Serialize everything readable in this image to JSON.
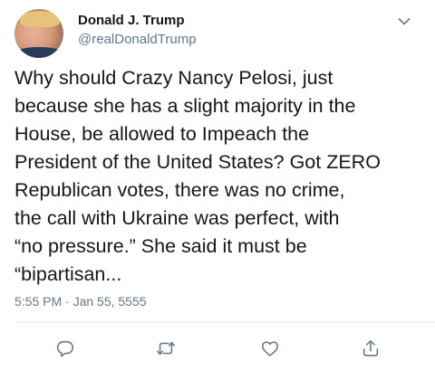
{
  "user": {
    "display_name": "Donald J. Trump",
    "handle": "@realDonaldTrump"
  },
  "tweet": {
    "text": "Why should Crazy Nancy Pelosi, just\nbecause she has a slight majority in the\nHouse, be allowed to Impeach the\nPresident of the United States? Got ZERO\nRepublican votes, there was no crime,\nthe call with Ukraine was perfect, with\n“no pressure.” She said it must be\n“bipartisan...",
    "timestamp": "5:55 PM · Jan 55, 5555"
  },
  "icons": {
    "menu": "chevron-down-icon",
    "reply": "reply-icon",
    "retweet": "retweet-icon",
    "like": "heart-icon",
    "share": "share-icon"
  },
  "colors": {
    "text": "#14171a",
    "secondary": "#657786",
    "divider": "#e6ecf0",
    "icon": "#657786"
  }
}
